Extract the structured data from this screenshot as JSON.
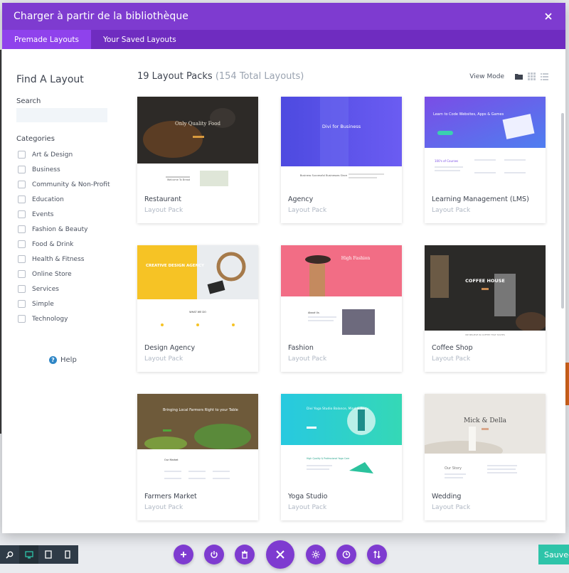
{
  "modal": {
    "title": "Charger à partir de la bibliothèque",
    "tabs": [
      {
        "label": "Premade Layouts",
        "active": true
      },
      {
        "label": "Your Saved Layouts",
        "active": false
      }
    ]
  },
  "sidebar": {
    "title": "Find A Layout",
    "search_label": "Search",
    "search_value": "",
    "categories_label": "Categories",
    "categories": [
      "Art & Design",
      "Business",
      "Community & Non-Profit",
      "Education",
      "Events",
      "Fashion & Beauty",
      "Food & Drink",
      "Health & Fitness",
      "Online Store",
      "Services",
      "Simple",
      "Technology"
    ],
    "help_label": "Help"
  },
  "main": {
    "title": "19 Layout Packs",
    "total": "(154 Total Layouts)",
    "view_mode_label": "View Mode",
    "cards": [
      {
        "name": "Restaurant",
        "type": "Layout Pack",
        "thumb": {
          "hero_text": "Only Quality Food",
          "sub_text": "Welcome To Bread"
        }
      },
      {
        "name": "Agency",
        "type": "Layout Pack",
        "thumb": {
          "hero_text": "Divi for Business",
          "sub_text": "Business Successful Businesses Since"
        }
      },
      {
        "name": "Learning Management (LMS)",
        "type": "Layout Pack",
        "thumb": {
          "hero_text": "Learn to Code Websites, Apps & Games",
          "sub_text": "100's of Courses"
        }
      },
      {
        "name": "Design Agency",
        "type": "Layout Pack",
        "thumb": {
          "hero_text": "CREATIVE DESIGN AGENCY",
          "sub_text": "WHAT WE DO"
        }
      },
      {
        "name": "Fashion",
        "type": "Layout Pack",
        "thumb": {
          "hero_text": "High Fashion",
          "sub_text": "About Us"
        }
      },
      {
        "name": "Coffee Shop",
        "type": "Layout Pack",
        "thumb": {
          "hero_text": "COFFEE HOUSE",
          "sub_text": "WE BELIEVE IN COFFEE THAT TASTES"
        }
      },
      {
        "name": "Farmers Market",
        "type": "Layout Pack",
        "thumb": {
          "hero_text": "Bringing Local Farmers Right to your Table",
          "sub_text": "Our Market"
        }
      },
      {
        "name": "Yoga Studio",
        "type": "Layout Pack",
        "thumb": {
          "hero_text": "Divi Yoga Studio Balance, Mind & Body",
          "sub_text": "High Quality & Professional Yoga Care"
        }
      },
      {
        "name": "Wedding",
        "type": "Layout Pack",
        "thumb": {
          "hero_text": "Mick & Della",
          "sub_text": "Our Story"
        }
      }
    ]
  },
  "bottom": {
    "save_label": "Sauvegar"
  },
  "colors": {
    "header": "#7e3bd0",
    "tabs_bar": "#6f2cc0",
    "active_tab": "#8f42ec",
    "save": "#2ec4a9",
    "device_bar": "#2f3b47"
  }
}
